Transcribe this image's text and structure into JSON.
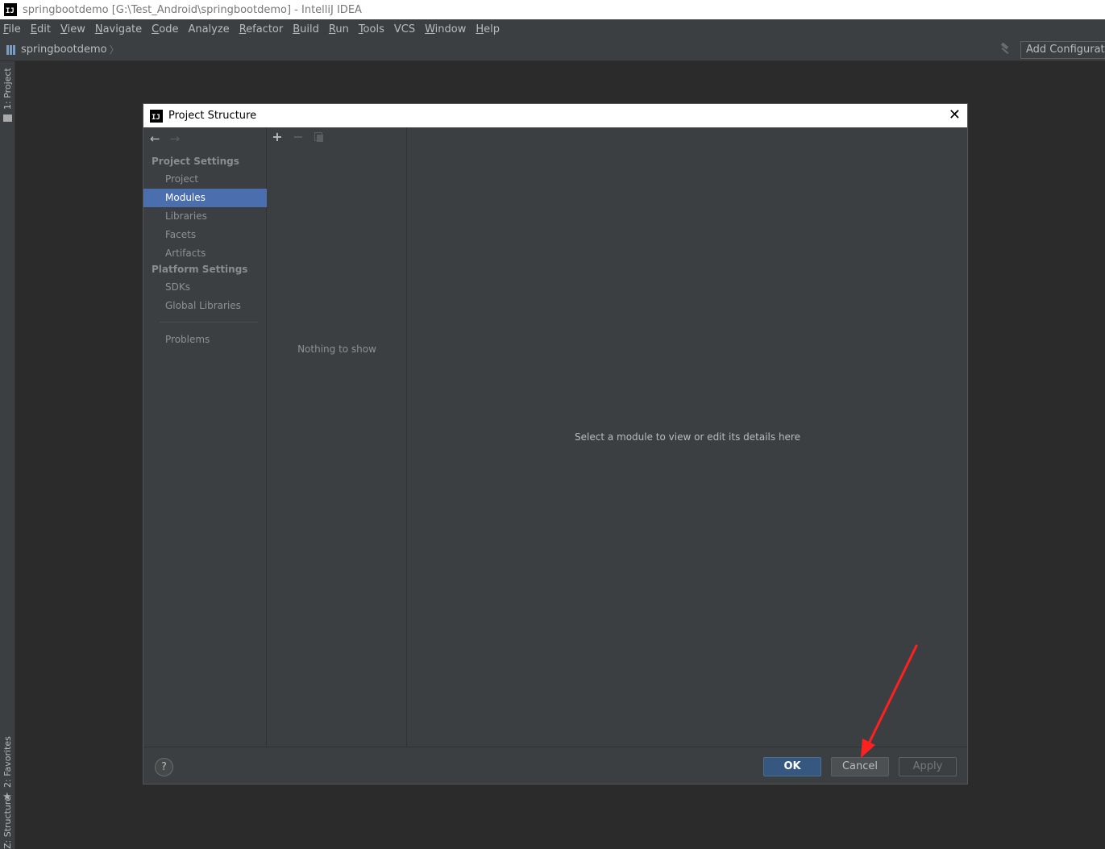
{
  "window": {
    "title": "springbootdemo [G:\\Test_Android\\springbootdemo] - IntelliJ IDEA",
    "logo_text": "IJ"
  },
  "menubar": {
    "items": [
      {
        "mnemonic": "F",
        "rest": "ile"
      },
      {
        "mnemonic": "E",
        "rest": "dit"
      },
      {
        "mnemonic": "V",
        "rest": "iew"
      },
      {
        "mnemonic": "N",
        "rest": "avigate"
      },
      {
        "mnemonic": "C",
        "rest": "ode"
      },
      {
        "mnemonic": "",
        "rest": "Analyze"
      },
      {
        "mnemonic": "R",
        "rest": "efactor"
      },
      {
        "mnemonic": "B",
        "rest": "uild"
      },
      {
        "mnemonic": "R",
        "rest": "un"
      },
      {
        "mnemonic": "T",
        "rest": "ools"
      },
      {
        "mnemonic": "",
        "rest": "VCS"
      },
      {
        "mnemonic": "W",
        "rest": "indow"
      },
      {
        "mnemonic": "H",
        "rest": "elp"
      }
    ]
  },
  "navbar": {
    "project": "springbootdemo",
    "separator": "〉",
    "add_configuration": "Add Configuration..."
  },
  "tool_strip": {
    "project_tab": "1: Project",
    "favorites_tab": "2: Favorites",
    "structure_tab": "Z: Structure"
  },
  "dialog": {
    "title": "Project Structure",
    "close": "✕",
    "nav": {
      "back": "←",
      "forward": "→",
      "project_settings_header": "Project Settings",
      "project_settings_items": [
        "Project",
        "Modules",
        "Libraries",
        "Facets",
        "Artifacts"
      ],
      "selected": "Modules",
      "platform_settings_header": "Platform Settings",
      "platform_settings_items": [
        "SDKs",
        "Global Libraries"
      ],
      "problems": "Problems"
    },
    "middle": {
      "add": "+",
      "remove": "−",
      "empty_text": "Nothing to show"
    },
    "detail": {
      "placeholder": "Select a module to view or edit its details here"
    },
    "footer": {
      "help": "?",
      "ok": "OK",
      "cancel": "Cancel",
      "apply": "Apply"
    }
  },
  "colors": {
    "selection": "#4b6eaf",
    "annotation_arrow": "#ff2020"
  }
}
